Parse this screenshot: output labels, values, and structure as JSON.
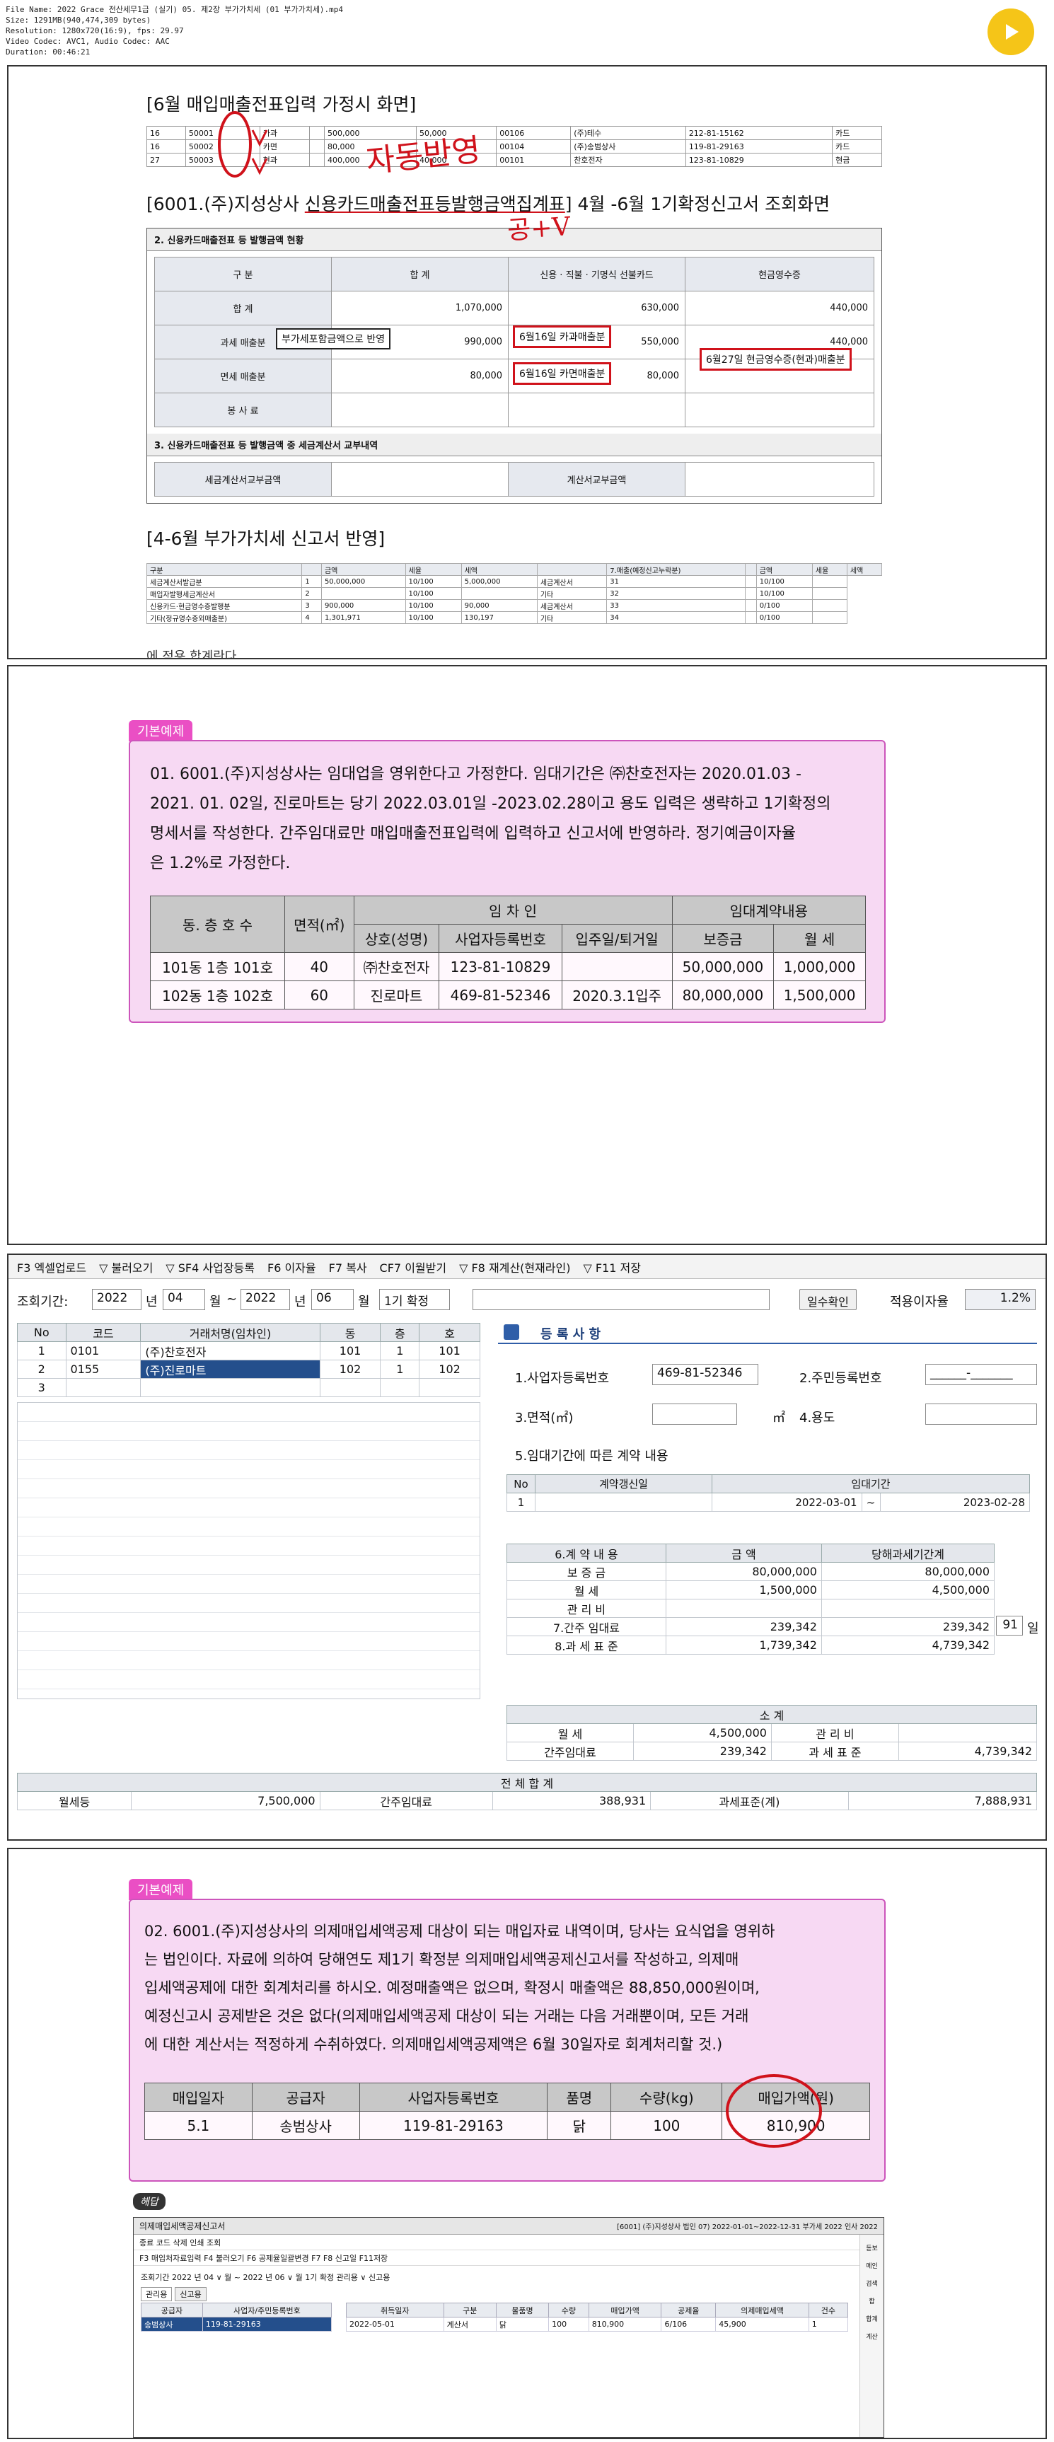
{
  "video_meta": {
    "file_name": "File Name: 2022 Grace 전산세무1급 (실기) 05. 제2장 부가가치세 (01 부가가치세).mp4",
    "size": "Size: 1291MB(940,474,309 bytes)",
    "resolution": "Resolution: 1280x720(16:9), fps: 29.97",
    "codec": "Video Codec: AVC1, Audio Codec: AAC",
    "duration": "Duration: 00:46:21"
  },
  "panel1": {
    "heading1": "[6월 매입매출전표입력 가정시 화면]",
    "mini_rows": [
      [
        "16",
        "50001",
        "카과",
        "",
        "500,000",
        "50,000",
        "00106",
        "(주)테수",
        "212-81-15162",
        "카드"
      ],
      [
        "16",
        "50002",
        "카면",
        "",
        "80,000",
        "",
        "00104",
        "(주)송범상사",
        "119-81-29163",
        "카드"
      ],
      [
        "27",
        "50003",
        "현과",
        "",
        "400,000",
        "40,000",
        "00101",
        "찬호전자",
        "123-81-10829",
        "현금"
      ]
    ],
    "heading2_prefix": "[6001.(주)지성상사 ",
    "heading2_u": "신용카드매출전표등발행금액집계표",
    "heading2_suffix": "] 4월 -6월 1기확정신고서 조회화면",
    "report_title": "2. 신용카드매출전표 등 발행금액 현황",
    "cols": [
      "구 분",
      "합 계",
      "신용 · 직불 · 기명식 선불카드",
      "현금영수증"
    ],
    "rows": {
      "total": [
        "합 계",
        "",
        "1,070,000",
        "630,000",
        "440,000"
      ],
      "taxable": [
        "과세 매출분",
        "990,000",
        "550,000",
        "440,000"
      ],
      "exempt": [
        "면세 매출분",
        "80,000",
        "80,000",
        ""
      ],
      "tip": [
        "봉 사 료",
        "",
        "",
        ""
      ]
    },
    "report_title2": "3. 신용카드매출전표 등 발행금액 중 세금계산서 교부내역",
    "tax_invoice_label": "세금계산서교부금액",
    "bill_label": "계산서교부금액",
    "ann_vat_included": "부가세포함금액으로 반영",
    "ann_jun16_card_tax": "6월16일 카과매출분",
    "ann_jun16_card_exempt": "6월16일 카면매출분",
    "ann_jun27_cash": "6월27일 현금영수증(현과)매출분",
    "handwrite1": "자동반영",
    "handwrite2": "공+V",
    "heading3": "[4-6월 부가가치세 신고서 반영]",
    "vat_header": [
      "구분",
      "",
      "금액",
      "세율",
      "세액",
      "",
      "7.매출(예정신고누락분)",
      "",
      "금액",
      "세율",
      "세액"
    ],
    "vat_rows": [
      [
        "세금계산서발급분",
        "1",
        "50,000,000",
        "10/100",
        "5,000,000",
        "세금계산서",
        "31",
        "",
        "10/100",
        ""
      ],
      [
        "매입자발행세금계산서",
        "2",
        "",
        "10/100",
        "",
        "기타",
        "32",
        "",
        "10/100",
        ""
      ],
      [
        "신용카드·현금영수증발행분",
        "3",
        "900,000",
        "10/100",
        "90,000",
        "세금계산서",
        "33",
        "",
        "0/100",
        ""
      ],
      [
        "기타(정규영수증외매출분)",
        "4",
        "1,301,971",
        "10/100",
        "130,197",
        "기타",
        "34",
        "",
        "0/100",
        ""
      ]
    ],
    "bottom_cut": "에 적용 합계란다."
  },
  "panel2": {
    "tab": "기본예제",
    "text_lines": [
      "01. 6001.(주)지성상사는 임대업을 영위한다고 가정한다. 임대기간은 ㈜찬호전자는 2020.01.03 -",
      "2021. 01. 02일, 진로마트는 당기 2022.03.01일 -2023.02.28이고 용도 입력은 생략하고 1기확정의",
      "명세서를 작성한다. 간주임대료만 매입매출전표입력에 입력하고 신고서에 반영하라. 정기예금이자율",
      "은 1.2%로 가정한다."
    ],
    "table_head1": [
      "동. 층 호 수",
      "면적(㎡)",
      "임 차 인",
      "임대계약내용"
    ],
    "table_head2": [
      "상호(성명)",
      "사업자등록번호",
      "입주일/퇴거일",
      "보증금",
      "월 세"
    ],
    "table_rows": [
      [
        "101동 1층 101호",
        "40",
        "㈜찬호전자",
        "123-81-10829",
        "",
        "50,000,000",
        "1,000,000"
      ],
      [
        "102동 1층 102호",
        "60",
        "진로마트",
        "469-81-52346",
        "2020.3.1입주",
        "80,000,000",
        "1,500,000"
      ]
    ]
  },
  "panel3": {
    "toolbar": [
      "F3 엑셀업로드",
      "▽ 불러오기",
      "▽ SF4 사업장등록",
      "F6 이자율",
      "F7 복사",
      "CF7 이월받기",
      "▽ F8 재계산(현재라인)",
      "▽ F11 저장"
    ],
    "period_label": "조회기간:",
    "from_year": "2022",
    "from_month": "04",
    "to_year": "2022",
    "to_month": "06",
    "nyeon": "년",
    "wol": "월",
    "tilde": "~",
    "period_btn": "1기 확정",
    "ilsu_btn": "일수확인",
    "rate_label": "적용이자율",
    "rate_value": "1.2%",
    "list_cols": [
      "No",
      "코드",
      "거래처명(임차인)",
      "동",
      "층",
      "호"
    ],
    "list_rows": [
      [
        "1",
        "0101",
        "(주)찬호전자",
        "101",
        "1",
        "101"
      ],
      [
        "2",
        "0155",
        "(주)진로마트",
        "102",
        "1",
        "102"
      ],
      [
        "3",
        "",
        "",
        "",
        "",
        ""
      ]
    ],
    "reg_title": "등 록 사 항",
    "f1": "1.사업자등록번호",
    "f1v": "469-81-52346",
    "f2": "2.주민등록번호",
    "f2v": "______-_______",
    "f3": "3.면적(㎡)",
    "f3u": "㎡",
    "f4": "4.용도",
    "f5": "5.임대기간에 따른 계약 내용",
    "contract_cols": [
      "No",
      "계약갱신일",
      "임대기간"
    ],
    "contract_row": [
      "1",
      "",
      "2022-03-01",
      "~",
      "2023-02-28"
    ],
    "detail_cols": [
      "6.계 약 내 용",
      "금 액",
      "당해과세기간계"
    ],
    "detail_rows": [
      [
        "보 증 금",
        "80,000,000",
        "80,000,000"
      ],
      [
        "월 세",
        "1,500,000",
        "4,500,000"
      ],
      [
        "관 리 비",
        "",
        ""
      ],
      [
        "7.간주 임대료",
        "239,342",
        "239,342"
      ],
      [
        "8.과 세 표 준",
        "1,739,342",
        "4,739,342"
      ]
    ],
    "days": "91",
    "il": "일",
    "subtotal_title": "소 계",
    "sub_rows": [
      [
        "월 세",
        "4,500,000",
        "관 리 비",
        ""
      ],
      [
        "간주임대료",
        "239,342",
        "과 세 표 준",
        "4,739,342"
      ]
    ],
    "total_title": "전 체 합 계",
    "total_row": [
      "월세등",
      "7,500,000",
      "간주임대료",
      "388,931",
      "과세표준(계)",
      "7,888,931"
    ]
  },
  "panel4": {
    "tab": "기본예제",
    "text_lines": [
      "02. 6001.(주)지성상사의 의제매입세액공제 대상이 되는 매입자료 내역이며, 당사는 요식업을 영위하",
      "는 법인이다. 자료에 의하여  당해연도 제1기 확정분 의제매입세액공제신고서를 작성하고, 의제매",
      "입세액공제에 대한 회계처리를 하시오. 예정매출액은 없으며, 확정시 매출액은 88,850,000원이며,",
      "예정신고시 공제받은 것은 없다(의제매입세액공제 대상이 되는 거래는 다음 거래뿐이며, 모든 거래",
      "에 대한 계산서는 적정하게 수취하였다. 의제매입세액공제액은 6월 30일자로 회계처리할 것.)"
    ],
    "table_head": [
      "매입일자",
      "공급자",
      "사업자등록번호",
      "품명",
      "수량(kg)",
      "매입가액(원)"
    ],
    "table_row": [
      "5.1",
      "송범상사",
      "119-81-29163",
      "닭",
      "100",
      "810,900"
    ],
    "sol_tag": "해답",
    "win_title": "의제매입세액공제신고서",
    "win_company": "[6001] (주)지성상사 법인 07) 2022-01-01~2022-12-31 부가세 2022 인사 2022",
    "win_toolbar1": "종료  코드  삭제  인쇄  조회",
    "win_toolbar2": "F3 매입처자료입력  F4 불러오기  F6 공제율일괄변경  F7  F8 신고일  F11저장",
    "win_period": "조회기간 2022 년 04 ∨ 월 ~ 2022 년 06 ∨ 월  1기 확정   관리용 ∨ 신고용",
    "win_tabs": [
      "관리용",
      "신고용"
    ],
    "left_cols": [
      "공급자",
      "사업자/주민등록번호"
    ],
    "left_row": [
      "송범상사",
      "119-81-29163"
    ],
    "right_cols": [
      "취득일자",
      "구분",
      "물품명",
      "수량",
      "매입가액",
      "공제율",
      "의제매입세액",
      "건수"
    ],
    "right_row": [
      "2022-05-01",
      "계산서",
      "닭",
      "100",
      "810,900",
      "6/106",
      "45,900",
      "1"
    ],
    "side_icons": [
      "돋보",
      "메인",
      "검색",
      "합",
      "합계",
      "계산"
    ]
  },
  "colors": {
    "exam_bg": "#f7d9f3",
    "exam_tab": "#ea4fc4",
    "red_ink": "#d0121b",
    "selected_row": "#244f8c",
    "play": "#f5c518"
  }
}
